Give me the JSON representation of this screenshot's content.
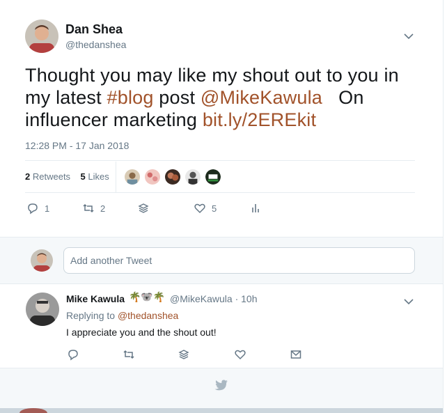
{
  "tweet": {
    "author_name": "Dan Shea",
    "author_handle": "@thedanshea",
    "text_parts": {
      "p1": "Thought you may like my shout out to you in my latest ",
      "hashtag": "#blog",
      "p2": " post ",
      "mention": "@MikeKawula",
      "p3": "   On influencer marketing ",
      "link": "bit.ly/2EREkit"
    },
    "timestamp": "12:28 PM - 17 Jan 2018",
    "retweets_count": "2",
    "retweets_label": "Retweets",
    "likes_count": "5",
    "likes_label": "Likes",
    "actions": {
      "reply_count": "1",
      "retweet_count": "2",
      "like_count": "5"
    }
  },
  "reply_box": {
    "placeholder": "Add another Tweet"
  },
  "reply": {
    "author_name": "Mike Kawula",
    "emojis": "🌴🐨🌴",
    "handle_time": "@MikeKawula · 10h",
    "replying_prefix": "Replying to ",
    "replying_to": "@thedanshea",
    "text": "I appreciate you and the shout out!"
  },
  "colors": {
    "link": "#a1522a",
    "secondary_text": "#657786",
    "divider": "#e6ecf0"
  }
}
